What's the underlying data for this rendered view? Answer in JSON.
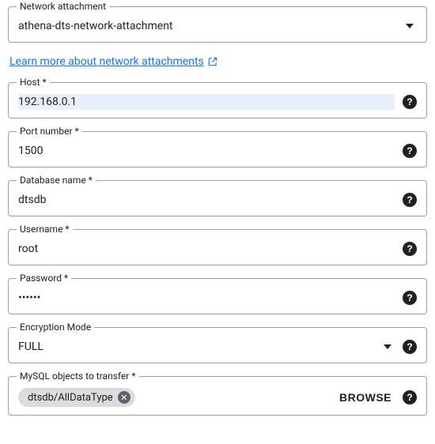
{
  "network_attachment": {
    "label": "Network attachment",
    "value": "athena-dts-network-attachment"
  },
  "learn_more": {
    "text": "Learn more about network attachments"
  },
  "host": {
    "label": "Host *",
    "value": "192.168.0.1"
  },
  "port": {
    "label": "Port number *",
    "value": "1500"
  },
  "database_name": {
    "label": "Database name *",
    "value": "dtsdb"
  },
  "username": {
    "label": "Username *",
    "value": "root"
  },
  "password": {
    "label": "Password *",
    "value": "••••••"
  },
  "encryption_mode": {
    "label": "Encryption Mode",
    "value": "FULL"
  },
  "mysql_objects": {
    "label": "MySQL objects to transfer *",
    "chip": "dtsdb/AllDataType",
    "browse": "BROWSE"
  },
  "icons": {
    "help": "?",
    "chip_close": "✕"
  }
}
